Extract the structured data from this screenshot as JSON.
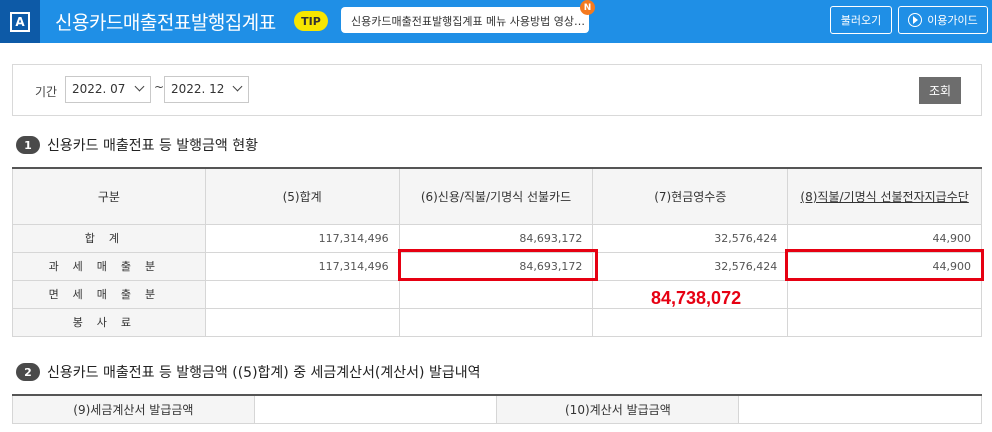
{
  "header": {
    "logo": "A",
    "title": "신용카드매출전표발행집계표",
    "tip_badge": "TIP",
    "tip_text": "신용카드매출전표발행집계표 메뉴 사용방법 영상…",
    "new_badge": "N",
    "load_button": "불러오기",
    "guide_button": "이용가이드"
  },
  "search": {
    "period_label": "기간",
    "from_value": "2022. 07",
    "separator": "~",
    "to_value": "2022. 12",
    "search_button": "조회"
  },
  "section1": {
    "number": "1",
    "title": "신용카드 매출전표 등 발행금액 현황",
    "columns": [
      "구분",
      "(5)합계",
      "(6)신용/직불/기명식 선불카드",
      "(7)현금영수증",
      "(8)직불/기명식 선불전자지급수단"
    ],
    "rows": [
      {
        "label": "합계",
        "values": [
          "117,314,496",
          "84,693,172",
          "32,576,424",
          "44,900"
        ]
      },
      {
        "label": "과세매출분",
        "values": [
          "117,314,496",
          "84,693,172",
          "32,576,424",
          "44,900"
        ]
      },
      {
        "label": "면세매출분",
        "values": [
          "",
          "",
          "",
          ""
        ]
      },
      {
        "label": "봉사료",
        "values": [
          "",
          "",
          "",
          ""
        ]
      }
    ]
  },
  "annotation": {
    "sum_value": "84,738,072",
    "color": "#e60012"
  },
  "section2": {
    "number": "2",
    "title": "신용카드 매출전표 등 발행금액 ((5)합계) 중 세금계산서(계산서) 발급내역",
    "label_9": "(9)세금계산서 발급금액",
    "value_9": "",
    "label_10": "(10)계산서 발급금액",
    "value_10": ""
  },
  "colors": {
    "header_bg": "#1f8fe6",
    "logo_bg": "#0d5aa7",
    "highlight": "#e60012"
  }
}
